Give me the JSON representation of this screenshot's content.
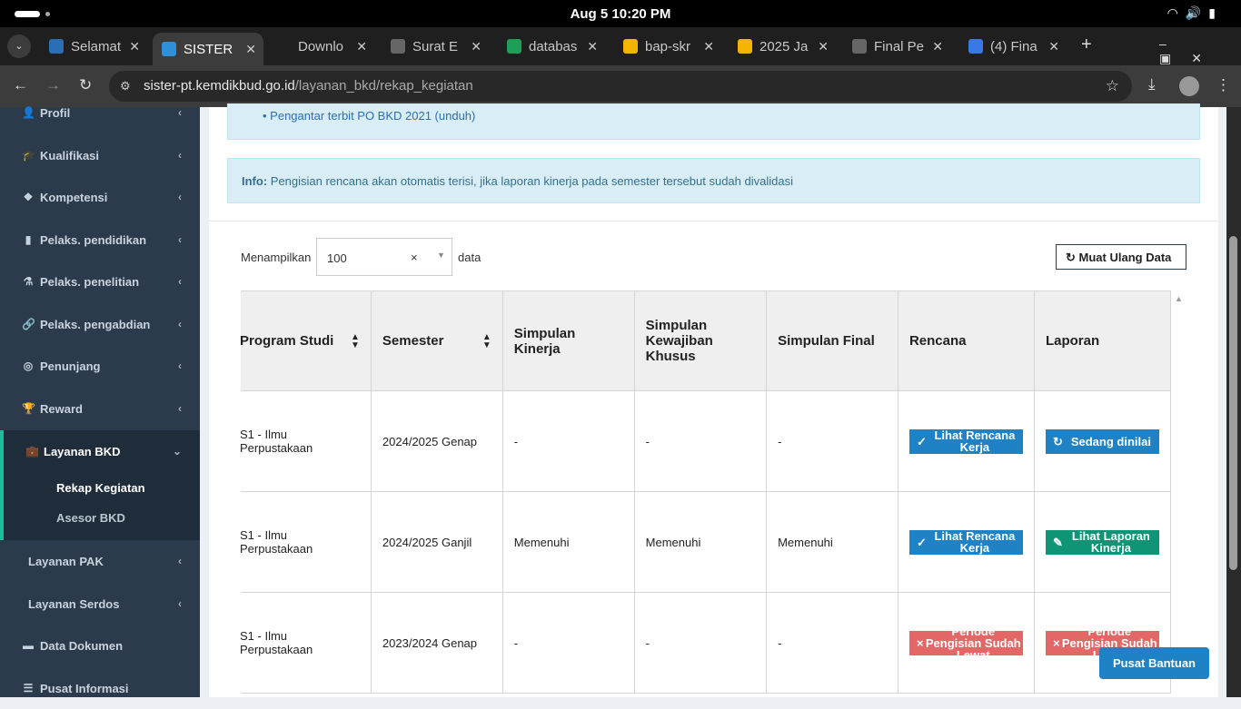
{
  "status_bar": {
    "datetime": "Aug 5  10:20 PM"
  },
  "browser": {
    "tabs": [
      {
        "label": "Selamat",
        "icon": "uin-logo-icon",
        "color": "#2a6fb5"
      },
      {
        "label": "SISTER",
        "icon": "sister-logo-icon",
        "color": "#2f8fd8",
        "active": true
      },
      {
        "label": "Downlo",
        "icon": "download-icon",
        "color": "#1f1f1f"
      },
      {
        "label": "Surat E",
        "icon": "globe-icon",
        "color": "#666"
      },
      {
        "label": "databas",
        "icon": "sheets-icon",
        "color": "#1e9f57"
      },
      {
        "label": "bap-skr",
        "icon": "drive-icon",
        "color": "#f4b400"
      },
      {
        "label": "2025 Ja",
        "icon": "drive-icon",
        "color": "#f4b400"
      },
      {
        "label": "Final Pe",
        "icon": "globe-icon",
        "color": "#666"
      },
      {
        "label": "(4) Fina",
        "icon": "docs-icon",
        "color": "#3b78e7"
      }
    ],
    "url_domain": "sister-pt.kemdikbud.go.id",
    "url_path": "/layanan_bkd/rekap_kegiatan"
  },
  "sidebar": {
    "items": [
      {
        "label": "Profil",
        "icon": "user-icon"
      },
      {
        "label": "Kualifikasi",
        "icon": "graduation-cap-icon"
      },
      {
        "label": "Kompetensi",
        "icon": "cubes-icon"
      },
      {
        "label": "Pelaks. pendidikan",
        "icon": "book-icon"
      },
      {
        "label": "Pelaks. penelitian",
        "icon": "flask-icon"
      },
      {
        "label": "Pelaks. pengabdian",
        "icon": "link-icon"
      },
      {
        "label": "Penunjang",
        "icon": "life-ring-icon"
      },
      {
        "label": "Reward",
        "icon": "trophy-icon"
      },
      {
        "label": "Layanan BKD",
        "icon": "briefcase-icon"
      },
      {
        "label": "Layanan PAK"
      },
      {
        "label": "Layanan Serdos"
      },
      {
        "label": "Data Dokumen",
        "icon": "folder-icon"
      },
      {
        "label": "Pusat Informasi",
        "icon": "list-icon"
      }
    ],
    "sub_items": [
      "Rekap Kegiatan",
      "Asesor BKD"
    ]
  },
  "main": {
    "link": "Pengantar terbit PO BKD 2021 (unduh)",
    "info_label": "Info:",
    "info_text": " Pengisian rencana akan otomatis terisi, jika laporan kinerja pada semester tersebut sudah divalidasi",
    "show_label": "Menampilkan",
    "show_value": "100",
    "show_suffix": "data",
    "reload_label": "Muat Ulang Data",
    "table": {
      "headers": [
        "Program Studi",
        "Semester",
        "Simpulan Kinerja",
        "Simpulan Kewajiban Khusus",
        "Simpulan Final",
        "Rencana",
        "Laporan"
      ],
      "rows": [
        {
          "prodi": "S1 - Ilmu Perpustakaan",
          "semester": "2024/2025 Genap",
          "kinerja": "-",
          "kewajiban": "-",
          "final": "-",
          "rencana": "Lihat Rencana Kerja",
          "laporan": "Sedang dinilai"
        },
        {
          "prodi": "S1 - Ilmu Perpustakaan",
          "semester": "2024/2025 Ganjil",
          "kinerja": "Memenuhi",
          "kewajiban": "Memenuhi",
          "final": "Memenuhi",
          "rencana": "Lihat Rencana Kerja",
          "laporan": "Lihat Laporan Kinerja"
        },
        {
          "prodi": "S1 - Ilmu Perpustakaan",
          "semester": "2023/2024 Genap",
          "kinerja": "-",
          "kewajiban": "-",
          "final": "-",
          "rencana": "Periode Pengisian Sudah Lewat",
          "laporan": "Periode Pengisian Sudah Lewat"
        }
      ]
    },
    "help_button": "Pusat Bantuan"
  },
  "colors": {
    "primary": "#1f82c4",
    "success": "#0f9576",
    "danger": "#e46767",
    "sidebar": "#2c3b4c"
  }
}
